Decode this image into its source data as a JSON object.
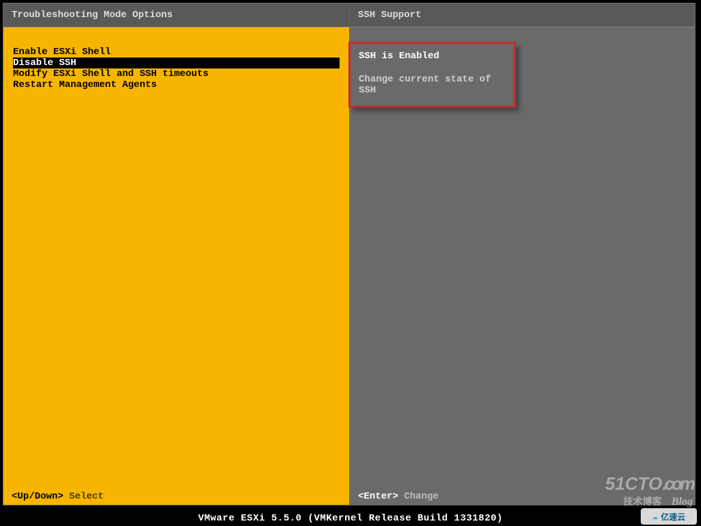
{
  "left": {
    "title": "Troubleshooting Mode Options",
    "menu": {
      "items": [
        {
          "label": "Enable ESXi Shell",
          "selected": false
        },
        {
          "label": "Disable SSH",
          "selected": true
        },
        {
          "label": "Modify ESXi Shell and SSH timeouts",
          "selected": false
        },
        {
          "label": "Restart Management Agents",
          "selected": false
        }
      ]
    },
    "hint_key": "<Up/Down>",
    "hint_action": "Select"
  },
  "right": {
    "title": "SSH Support",
    "status": "SSH is Enabled",
    "description": "Change current state of SSH",
    "hint_key": "<Enter>",
    "hint_action": "Change"
  },
  "status_bar": "VMware ESXi 5.5.0 (VMKernel Release Build 1331820)",
  "watermarks": {
    "cto_brand": "51CTO",
    "cto_suffix": ".com",
    "cto_cn": "技术博客",
    "cto_blog": "Blog",
    "yisu": "亿速云"
  }
}
